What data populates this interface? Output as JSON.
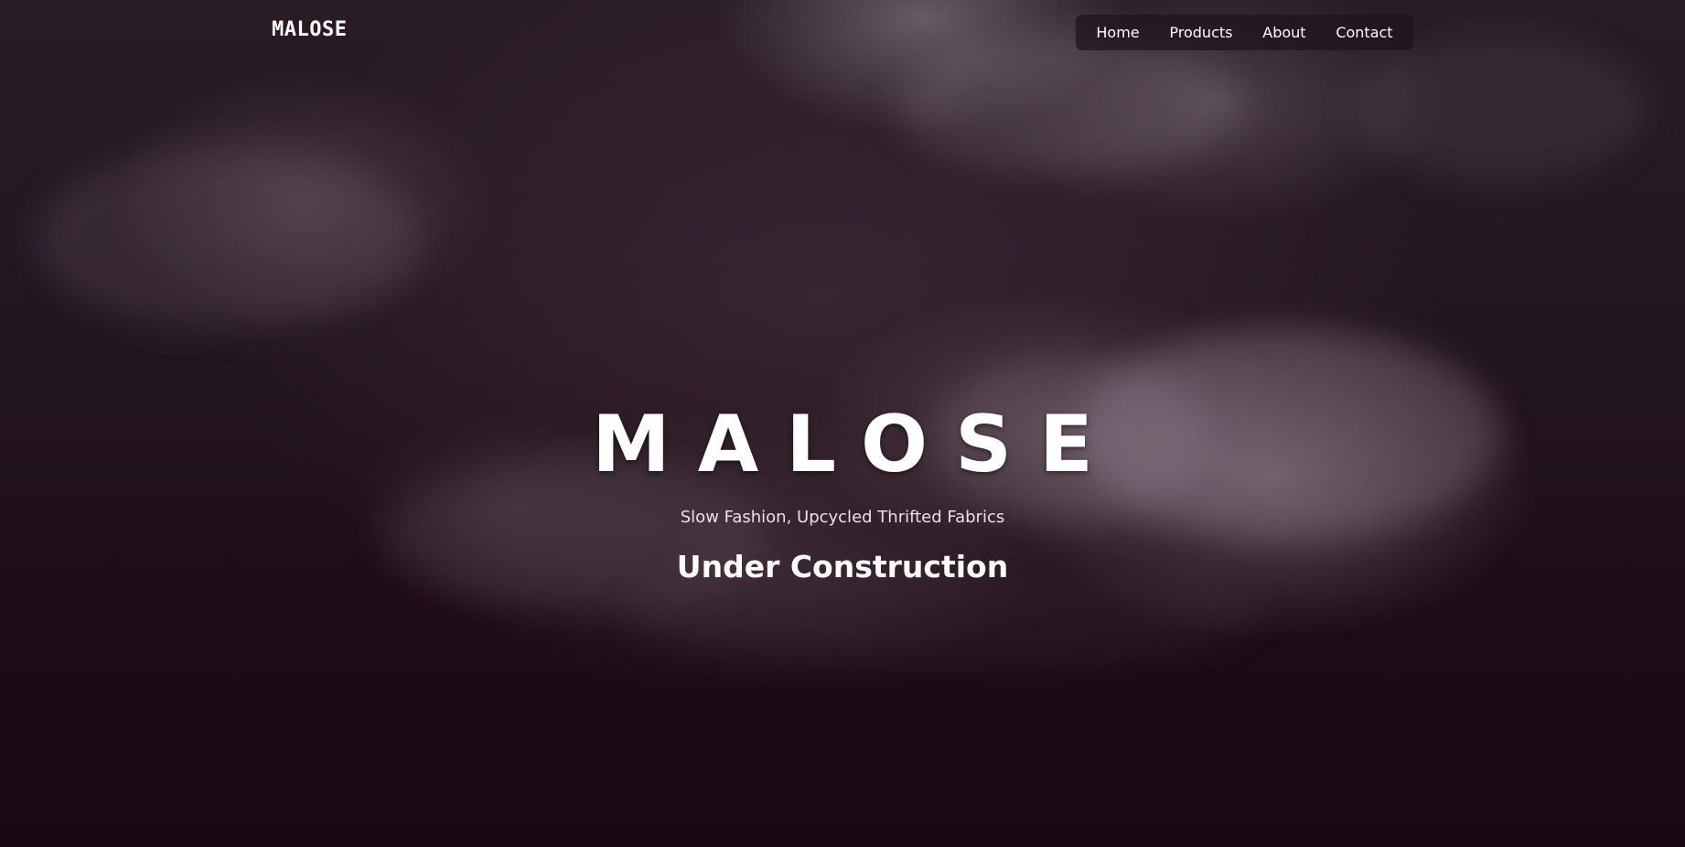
{
  "header": {
    "logo": "MALOSE"
  },
  "nav": {
    "items": [
      {
        "label": "Home"
      },
      {
        "label": "Products"
      },
      {
        "label": "About"
      },
      {
        "label": "Contact"
      }
    ]
  },
  "hero": {
    "title": "MALOSE",
    "subtitle": "Slow Fashion, Upcycled Thrifted Fabrics",
    "status": "Under Construction"
  }
}
